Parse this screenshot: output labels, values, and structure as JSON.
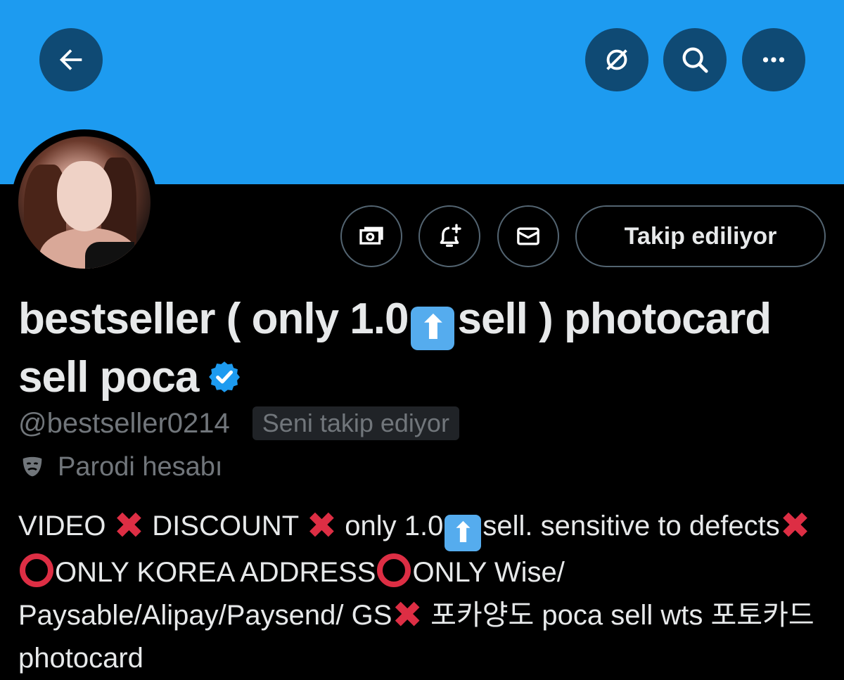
{
  "header": {
    "back_icon": "arrow-left-icon",
    "grok_icon": "grok-icon",
    "search_icon": "search-icon",
    "more_icon": "more-horizontal-icon",
    "banner_color": "#1d9bf0"
  },
  "actions": {
    "subscription_icon": "money-icon",
    "notify_icon": "bell-plus-icon",
    "message_icon": "envelope-icon",
    "follow_label": "Takip ediliyor"
  },
  "profile": {
    "name_part1": "bestseller ( only 1.0",
    "name_emoji": "⬆",
    "name_part2": "sell ) photocard sell poca",
    "verified_color": "#1d9bf0",
    "handle": "@bestseller0214",
    "follows_you_badge": "Seni takip ediyor",
    "parody_label": "Parodi hesabı"
  },
  "bio": {
    "t1": "VIDEO ",
    "x1": "✖",
    "t2": " DISCOUNT ",
    "x2": "✖",
    "t3": " only 1.0",
    "up": "⬆",
    "t4": "sell. sensitive to defects",
    "x3": "✖",
    "t5": " ",
    "t6": "ONLY KOREA ADDRESS",
    "t7": "ONLY Wise/ Paysable/Alipay/Paysend/ GS",
    "x4": "✖",
    "t8": " 포카양도 poca sell wts 포토카드 photocard"
  }
}
